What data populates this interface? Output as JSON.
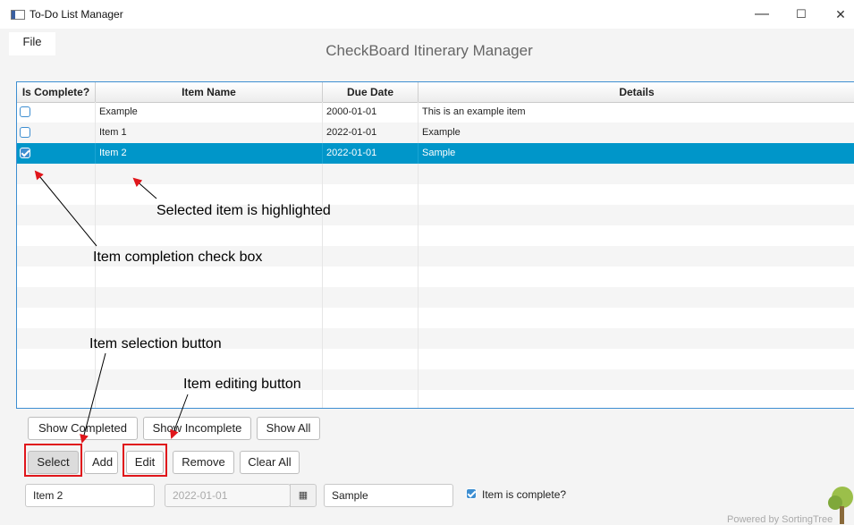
{
  "window": {
    "title": "To-Do List Manager",
    "minimize": "—",
    "maximize": "☐",
    "close": "✕"
  },
  "menu": {
    "file": "File"
  },
  "app_title": "CheckBoard Itinerary Manager",
  "table": {
    "columns": [
      "Is Complete?",
      "Item Name",
      "Due Date",
      "Details"
    ],
    "rows": [
      {
        "complete": false,
        "name": "Example",
        "due": "2000-01-01",
        "details": "This is an example item"
      },
      {
        "complete": false,
        "name": "Item 1",
        "due": "2022-01-01",
        "details": "Example"
      },
      {
        "complete": true,
        "name": "Item 2",
        "due": "2022-01-01",
        "details": "Sample",
        "selected": true
      }
    ]
  },
  "annotations": {
    "selected": "Selected item is highlighted",
    "checkbox": "Item completion check box",
    "select_btn": "Item selection button",
    "edit_btn": "Item editing button"
  },
  "filters": {
    "completed": "Show Completed",
    "incomplete": "Show Incomplete",
    "all": "Show All"
  },
  "actions": {
    "select": "Select",
    "add": "Add",
    "edit": "Edit",
    "remove": "Remove",
    "clear": "Clear All"
  },
  "editor": {
    "name": "Item 2",
    "date": "2022-01-01",
    "details": "Sample",
    "complete_label": "Item is complete?"
  },
  "footer": "Powered by SortingTree",
  "colors": {
    "accent": "#3d8ed1",
    "selection": "#0096c9",
    "annotation_red": "#e0161b"
  }
}
